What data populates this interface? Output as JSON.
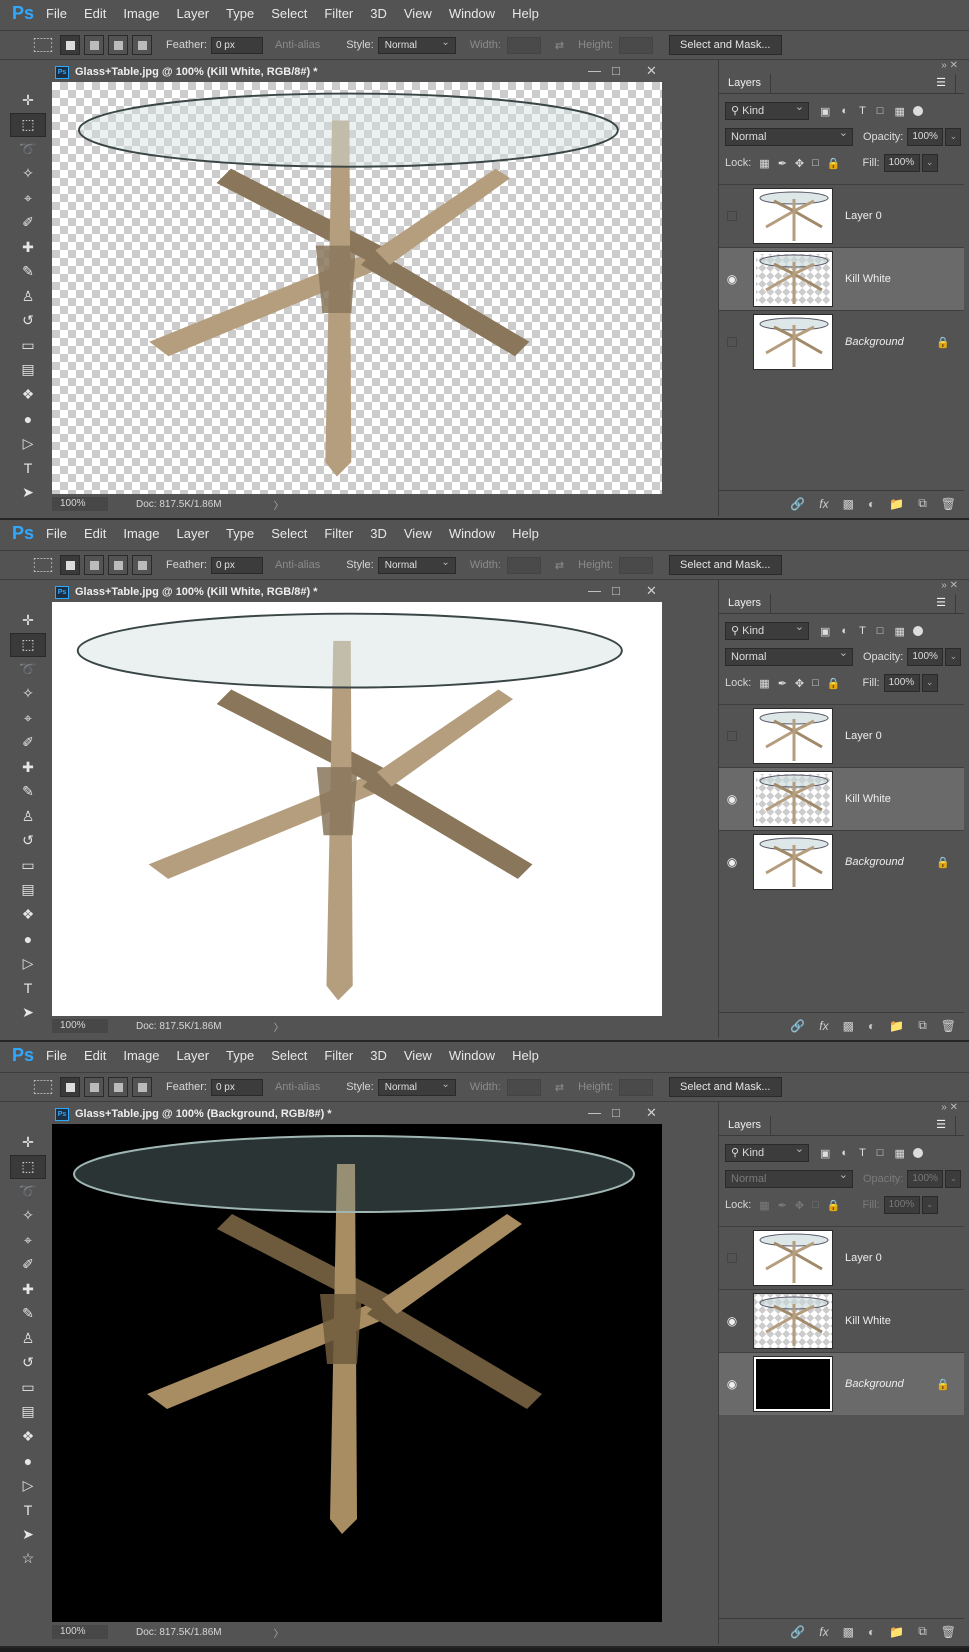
{
  "app": {
    "logo": "Ps"
  },
  "menu": [
    "File",
    "Edit",
    "Image",
    "Layer",
    "Type",
    "Select",
    "Filter",
    "3D",
    "View",
    "Window",
    "Help"
  ],
  "options": {
    "feather_label": "Feather:",
    "feather_value": "0 px",
    "antialias_label": "Anti-alias",
    "style_label": "Style:",
    "style_value": "Normal",
    "width_label": "Width:",
    "height_label": "Height:",
    "select_mask": "Select and Mask..."
  },
  "layers_panel": {
    "title": "Layers",
    "kind": "Kind",
    "opacity_label": "Opacity:",
    "fill_label": "Fill:",
    "lock_label": "Lock:"
  },
  "shots": [
    {
      "doc_title": "Glass+Table.jpg @ 100% (Kill White, RGB/8#) *",
      "canvas_bg": "transparent",
      "zoom": "100%",
      "doc_size": "Doc: 817.5K/1.86M",
      "blend": "Normal",
      "opacity": "100%",
      "fill": "100%",
      "layers": [
        {
          "name": "Layer 0",
          "visible": false,
          "active": false,
          "thumb": "white",
          "locked": false
        },
        {
          "name": "Kill White",
          "visible": true,
          "active": true,
          "thumb": "transparent",
          "locked": false
        },
        {
          "name": "Background",
          "visible": false,
          "active": false,
          "thumb": "white",
          "locked": true
        }
      ]
    },
    {
      "doc_title": "Glass+Table.jpg @ 100% (Kill White, RGB/8#) *",
      "canvas_bg": "white",
      "zoom": "100%",
      "doc_size": "Doc: 817.5K/1.86M",
      "blend": "Normal",
      "opacity": "100%",
      "fill": "100%",
      "layers": [
        {
          "name": "Layer 0",
          "visible": false,
          "active": false,
          "thumb": "white",
          "locked": false
        },
        {
          "name": "Kill White",
          "visible": true,
          "active": true,
          "thumb": "transparent",
          "locked": false
        },
        {
          "name": "Background",
          "visible": true,
          "active": false,
          "thumb": "white",
          "locked": true
        }
      ]
    },
    {
      "doc_title": "Glass+Table.jpg @ 100% (Background, RGB/8#) *",
      "canvas_bg": "black",
      "zoom": "100%",
      "doc_size": "Doc: 817.5K/1.86M",
      "blend": "Normal",
      "opacity": "100%",
      "fill": "100%",
      "layers": [
        {
          "name": "Layer 0",
          "visible": false,
          "active": false,
          "thumb": "white",
          "locked": false
        },
        {
          "name": "Kill White",
          "visible": true,
          "active": false,
          "thumb": "transparent",
          "locked": false
        },
        {
          "name": "Background",
          "visible": true,
          "active": true,
          "thumb": "black",
          "locked": true
        }
      ]
    }
  ],
  "icons": [
    "ps-logo",
    "marquee-icon",
    "move-icon",
    "lasso-icon",
    "magic-wand-icon",
    "crop-icon",
    "eyedropper-icon",
    "healing-icon",
    "brush-icon",
    "stamp-icon",
    "history-brush-icon",
    "eraser-icon",
    "gradient-icon",
    "blur-icon",
    "dodge-icon",
    "pen-icon",
    "type-icon",
    "path-select-icon",
    "shape-icon",
    "eye-icon",
    "lock-icon",
    "link-icon",
    "fx-icon",
    "mask-icon",
    "adjustment-icon",
    "folder-icon",
    "new-layer-icon",
    "trash-icon"
  ]
}
